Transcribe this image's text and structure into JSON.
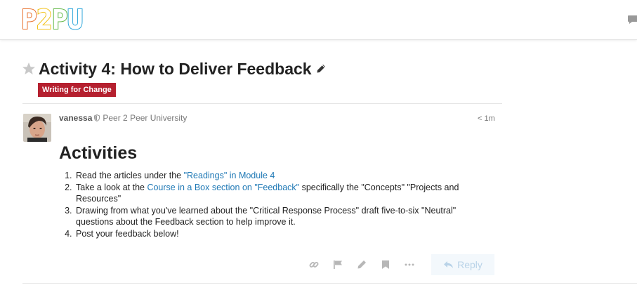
{
  "header": {
    "logo_letters": [
      "P",
      "2",
      "P",
      "U"
    ],
    "logo_colors": [
      "#e8732f",
      "#f2c21a",
      "#62b846",
      "#33a9db"
    ]
  },
  "topic": {
    "title": "Activity 4: How to Deliver Feedback",
    "category": "Writing for Change",
    "category_color": "#b5202f"
  },
  "post": {
    "username": "vanessa",
    "user_title": "Peer 2 Peer University",
    "age": "< 1m",
    "heading": "Activities",
    "items": [
      {
        "before": "Read the articles under the ",
        "link": "\"Readings\" in Module 4",
        "after": ""
      },
      {
        "before": "Take a look at the ",
        "link": "Course in a Box section on \"Feedback\"",
        "after": " specifically the \"Concepts\" \"Projects and Resources\""
      },
      {
        "before": "Drawing from what you've learned about the \"Critical Response Process\" draft five-to-six \"Neutral\" questions about the Feedback section to help improve it.",
        "link": "",
        "after": ""
      },
      {
        "before": "Post your feedback below!",
        "link": "",
        "after": ""
      }
    ]
  },
  "actions": {
    "icons": [
      "link-icon",
      "flag-icon",
      "edit-icon",
      "bookmark-icon",
      "more-icon"
    ],
    "reply_label": "Reply"
  }
}
